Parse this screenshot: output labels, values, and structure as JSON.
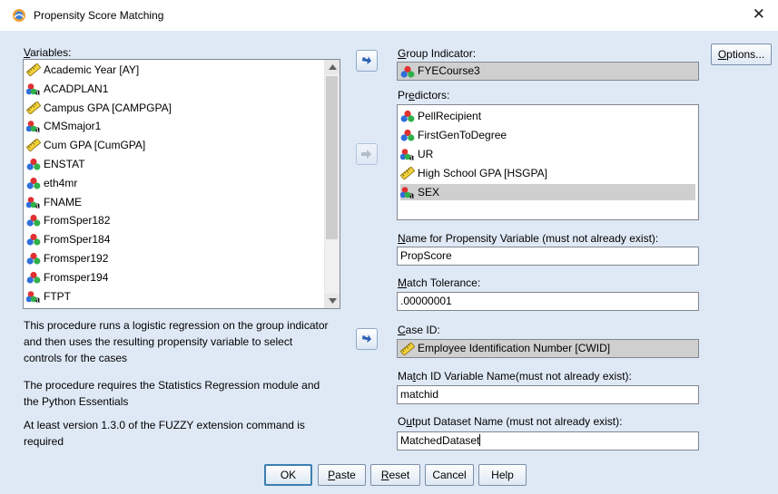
{
  "window": {
    "title": "Propensity Score Matching",
    "close_glyph": "✕"
  },
  "variables": {
    "label_first": "V",
    "label_rest": "ariables:",
    "items": [
      {
        "icon": "scale-icon",
        "label": "Academic Year [AY]"
      },
      {
        "icon": "nominal-string-icon",
        "label": "ACADPLAN1"
      },
      {
        "icon": "scale-icon",
        "label": "Campus GPA [CAMPGPA]"
      },
      {
        "icon": "nominal-string-icon",
        "label": "CMSmajor1"
      },
      {
        "icon": "scale-icon",
        "label": "Cum GPA [CumGPA]"
      },
      {
        "icon": "nominal-icon",
        "label": "ENSTAT"
      },
      {
        "icon": "nominal-icon",
        "label": "eth4mr"
      },
      {
        "icon": "nominal-string-icon",
        "label": "FNAME"
      },
      {
        "icon": "nominal-icon",
        "label": "FromSper182"
      },
      {
        "icon": "nominal-icon",
        "label": "FromSper184"
      },
      {
        "icon": "nominal-icon",
        "label": "Fromsper192"
      },
      {
        "icon": "nominal-icon",
        "label": "Fromsper194"
      },
      {
        "icon": "nominal-string-icon",
        "label": "FTPT"
      }
    ]
  },
  "group_indicator": {
    "label_first": "G",
    "label_rest": "roup Indicator:",
    "value": "FYECourse3",
    "icon": "nominal-icon"
  },
  "predictors": {
    "label_pre": "Pr",
    "label_u": "e",
    "label_post": "dictors:",
    "items": [
      {
        "icon": "nominal-icon",
        "label": "PellRecipient",
        "selected": false
      },
      {
        "icon": "nominal-icon",
        "label": "FirstGenToDegree",
        "selected": false
      },
      {
        "icon": "nominal-string-icon",
        "label": "UR",
        "selected": false
      },
      {
        "icon": "scale-icon",
        "label": "High School GPA [HSGPA]",
        "selected": false
      },
      {
        "icon": "nominal-string-icon",
        "label": "SEX",
        "selected": true
      }
    ]
  },
  "propensity": {
    "label_first": "N",
    "label_rest": "ame for Propensity Variable (must not already exist):",
    "value": "PropScore"
  },
  "tolerance": {
    "label_first": "M",
    "label_rest": "atch Tolerance:",
    "value": ".00000001"
  },
  "case_id": {
    "label_first": "C",
    "label_rest": "ase ID:",
    "value": "Employee Identification Number [CWID]",
    "icon": "scale-icon"
  },
  "match_id": {
    "label_pre": "Ma",
    "label_u": "t",
    "label_post": "ch ID Variable Name(must not already exist):",
    "value": "matchid"
  },
  "output": {
    "label_pre": "O",
    "label_u": "u",
    "label_post": "tput Dataset Name (must not already exist):",
    "value": "MatchedDataset"
  },
  "info": {
    "p1": "This procedure runs a logistic regression on the group indicator and then uses the resulting propensity variable to select controls for the cases",
    "p2": "The procedure requires the Statistics Regression module and the Python Essentials",
    "p3": "At least version 1.3.0 of  the FUZZY extension command is required"
  },
  "buttons": {
    "options_u": "O",
    "options_rest": "ptions...",
    "ok": "OK",
    "paste_u": "P",
    "paste_rest": "aste",
    "reset_u": "R",
    "reset_rest": "eset",
    "cancel": "Cancel",
    "help": "Help"
  }
}
